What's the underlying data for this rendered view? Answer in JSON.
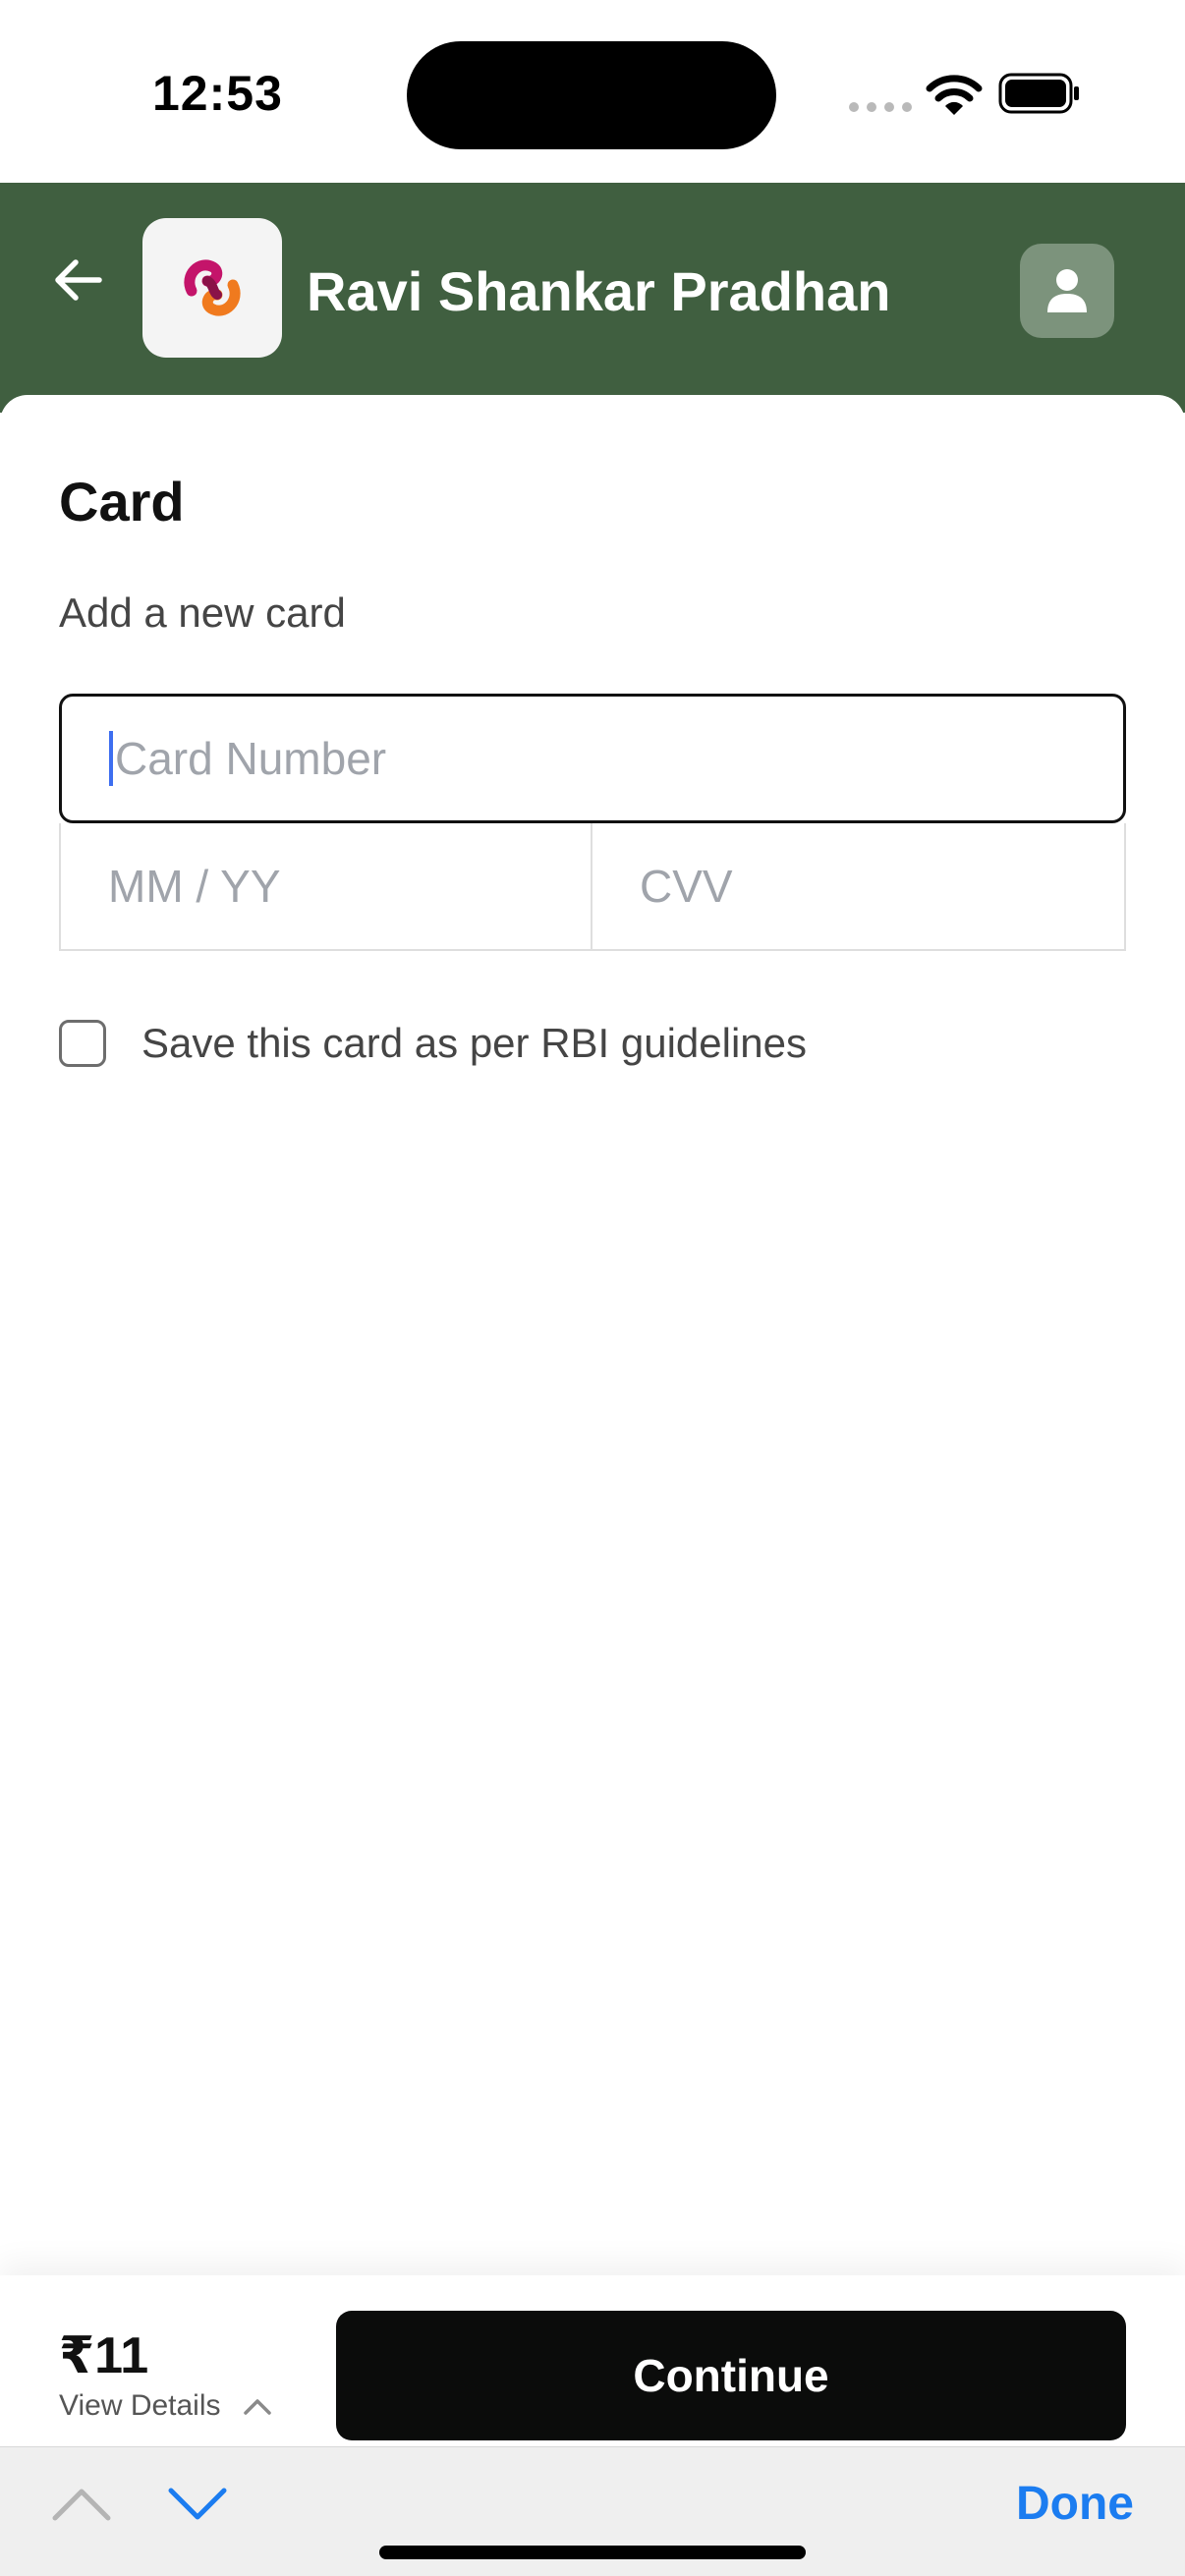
{
  "status_bar": {
    "time": "12:53"
  },
  "header": {
    "merchant_name": "Ravi Shankar Pradhan",
    "background_color": "#405f40",
    "icons": {
      "back": "back-arrow-icon",
      "logo": "merchant-logo",
      "profile": "user-profile-icon"
    }
  },
  "card_section": {
    "title": "Card",
    "subtitle": "Add a new card",
    "card_number_placeholder": "Card Number",
    "expiry_placeholder": "MM / YY",
    "cvv_placeholder": "CVV",
    "save_card_label": "Save this card as per RBI guidelines",
    "save_card_checked": false
  },
  "footer": {
    "amount": "₹11",
    "view_details_label": "View Details",
    "continue_label": "Continue"
  },
  "keyboard_accessory": {
    "done_label": "Done",
    "accent_color": "#1b7cf0"
  }
}
